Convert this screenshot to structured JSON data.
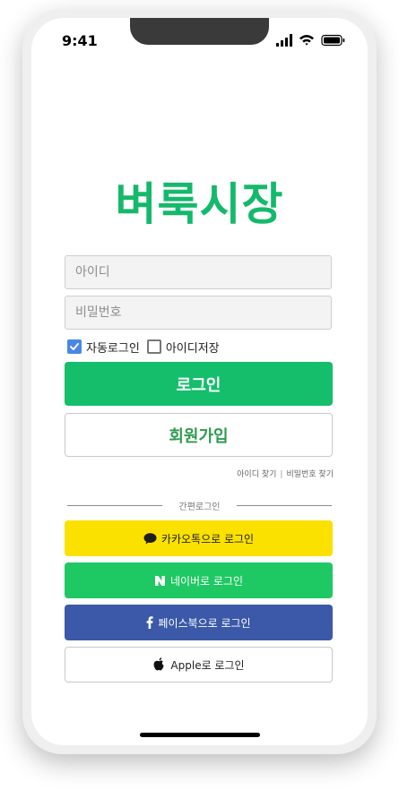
{
  "status_bar": {
    "time": "9:41"
  },
  "brand": {
    "title": "벼룩시장"
  },
  "login_form": {
    "id_placeholder": "아이디",
    "password_placeholder": "비밀번호",
    "auto_login_label": "자동로그인",
    "auto_login_checked": true,
    "save_id_label": "아이디저장",
    "save_id_checked": false,
    "login_button": "로그인",
    "signup_button": "회원가입",
    "find_id_link": "아이디 찾기",
    "link_separator": "|",
    "find_password_link": "비밀번호 찾기"
  },
  "easy_login": {
    "divider_label": "간편로그인",
    "kakao_button": "카카오톡으로 로그인",
    "naver_button": "네이버로 로그인",
    "facebook_button": "페이스북으로 로그인",
    "apple_button": "Apple로 로그인"
  },
  "colors": {
    "brand_green": "#14b96b",
    "kakao_yellow": "#fae100",
    "naver_green": "#1ec862",
    "facebook_blue": "#3b59a8",
    "checkbox_blue": "#4a86e8"
  },
  "icons": [
    "cellular-signal-icon",
    "wifi-icon",
    "battery-icon",
    "checkmark-icon",
    "kakao-speech-bubble-icon",
    "naver-n-icon",
    "facebook-f-icon",
    "apple-logo-icon"
  ]
}
